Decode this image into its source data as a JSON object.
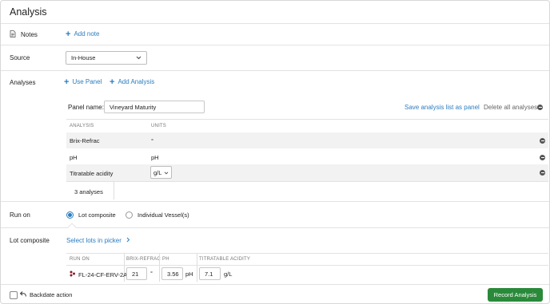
{
  "header": {
    "title": "Analysis"
  },
  "notes": {
    "label": "Notes",
    "add_note": "Add note"
  },
  "source": {
    "label": "Source",
    "selected": "In-House"
  },
  "analyses": {
    "label": "Analyses",
    "use_panel": "Use Panel",
    "add_analysis": "Add Analysis",
    "panel_name_label": "Panel name:",
    "panel_name_value": "Vineyard Maturity",
    "save_panel": "Save analysis list as panel",
    "delete_all": "Delete all analyses",
    "columns": [
      "ANALYSIS",
      "UNITS"
    ],
    "rows": [
      {
        "analysis": "Brix-Refrac",
        "units": "°"
      },
      {
        "analysis": "pH",
        "units": "pH"
      },
      {
        "analysis": "Titratable acidity",
        "units": "g/L"
      }
    ],
    "count": "3 analyses"
  },
  "run_on": {
    "label": "Run on",
    "options": [
      "Lot composite",
      "Individual Vessel(s)"
    ],
    "selected": "Lot composite"
  },
  "lot_composite": {
    "label": "Lot composite",
    "select_lots": "Select lots in picker",
    "columns": [
      "RUN ON",
      "BRIX-REFRAC",
      "PH",
      "TITRATABLE ACIDITY"
    ],
    "row": {
      "lot": "FL-24-CF-ERV-2A",
      "brix": "21",
      "brix_unit": "°",
      "ph": "3.56",
      "ph_unit": "pH",
      "ta": "7.1",
      "ta_unit": "g/L"
    }
  },
  "footer": {
    "backdate": "Backdate action",
    "record": "Record Analysis"
  },
  "colors": {
    "accent": "#2b7dc0",
    "primary_button": "#2a8a3a",
    "lot_icon": "#8b1a2b"
  }
}
